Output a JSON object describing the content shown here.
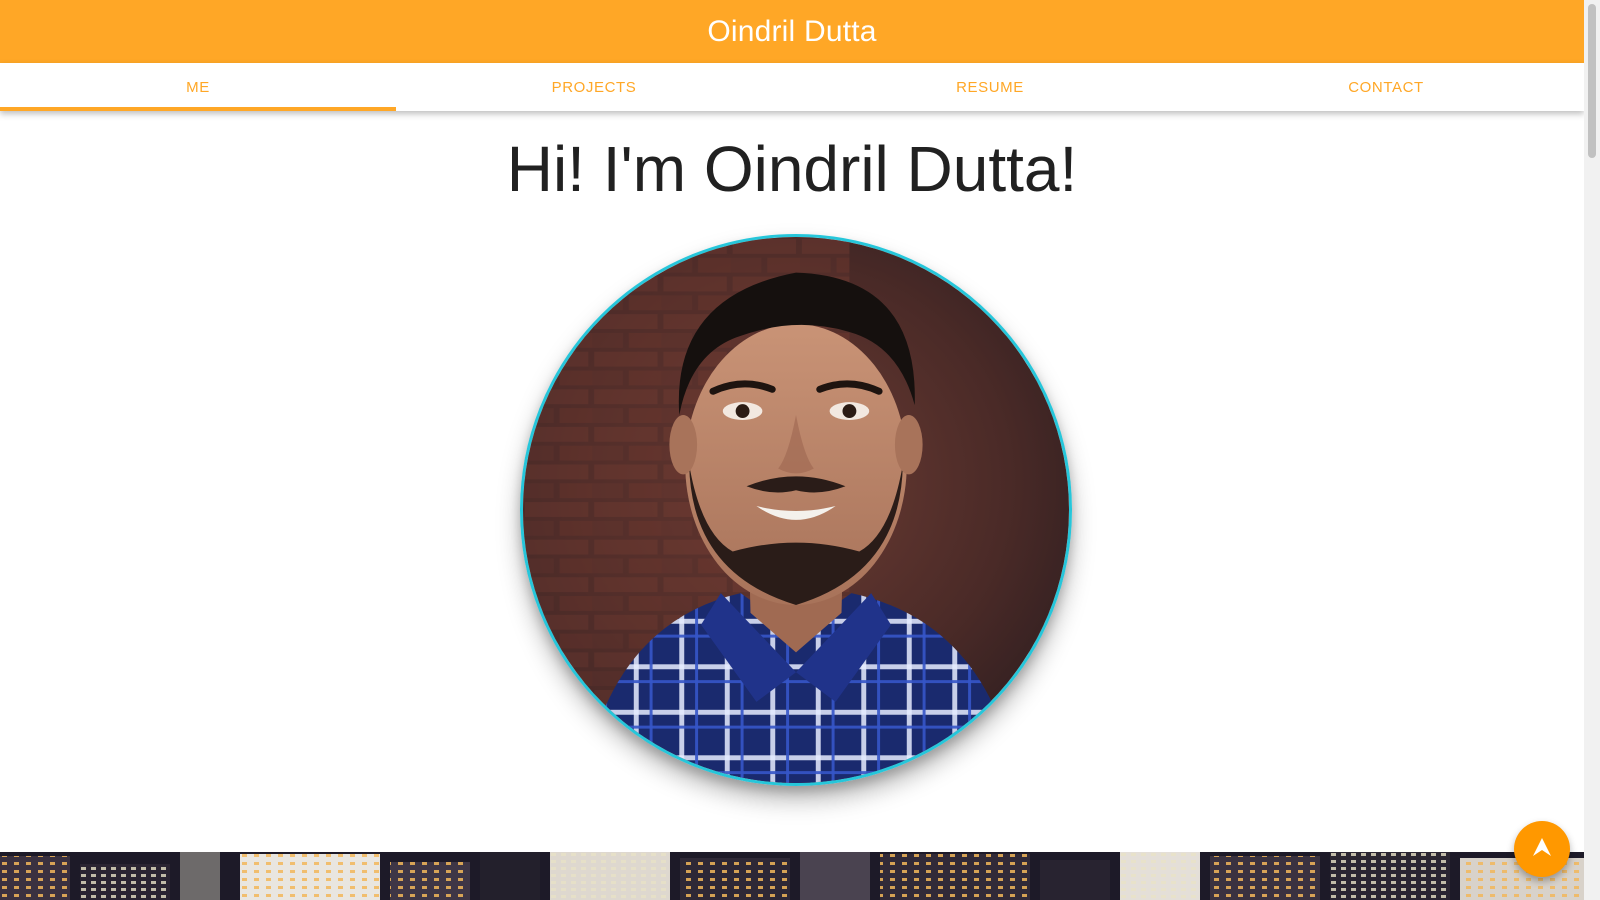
{
  "header": {
    "title": "Oindril Dutta"
  },
  "tabs": [
    {
      "label": "ME",
      "active": true
    },
    {
      "label": "PROJECTS",
      "active": false
    },
    {
      "label": "RESUME",
      "active": false
    },
    {
      "label": "CONTACT",
      "active": false
    }
  ],
  "hero": {
    "heading": "Hi! I'm Oindril Dutta!"
  },
  "portrait": {
    "icon": "profile-photo"
  },
  "fab": {
    "icon": "arrow-up-icon"
  },
  "colors": {
    "accent": "#ffa726",
    "fab": "#ff9800",
    "portrait_border": "#26c6da",
    "heading": "#212121"
  }
}
